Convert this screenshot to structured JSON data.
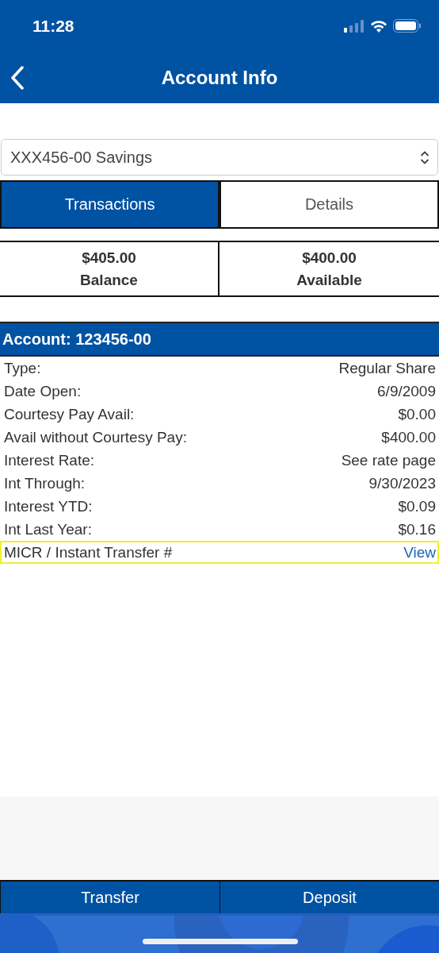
{
  "status_bar": {
    "time": "11:28"
  },
  "nav": {
    "title": "Account Info"
  },
  "account_select": {
    "value": "XXX456-00 Savings"
  },
  "tabs": [
    {
      "label": "Transactions",
      "selected": true
    },
    {
      "label": "Details",
      "selected": false
    }
  ],
  "balances": [
    {
      "amount": "$405.00",
      "label": "Balance"
    },
    {
      "amount": "$400.00",
      "label": "Available"
    }
  ],
  "account": {
    "title": "Account: 123456-00",
    "rows": [
      {
        "label": "Type:",
        "value": "Regular Share",
        "kind": "value",
        "highlighted": false
      },
      {
        "label": "Date Open:",
        "value": "6/9/2009",
        "kind": "value",
        "highlighted": false
      },
      {
        "label": "Courtesy Pay Avail:",
        "value": "$0.00",
        "kind": "value",
        "highlighted": false
      },
      {
        "label": "Avail without Courtesy Pay:",
        "value": "$400.00",
        "kind": "value",
        "highlighted": false
      },
      {
        "label": "Interest Rate:",
        "value": "See rate page",
        "kind": "value",
        "highlighted": false
      },
      {
        "label": "Int Through:",
        "value": "9/30/2023",
        "kind": "value",
        "highlighted": false
      },
      {
        "label": "Interest YTD:",
        "value": "$0.09",
        "kind": "value",
        "highlighted": false
      },
      {
        "label": "Int Last Year:",
        "value": "$0.16",
        "kind": "value",
        "highlighted": false
      },
      {
        "label": "MICR / Instant Transfer #",
        "value": "View",
        "kind": "link",
        "highlighted": true
      }
    ]
  },
  "actions": [
    "Transfer",
    "Deposit"
  ]
}
